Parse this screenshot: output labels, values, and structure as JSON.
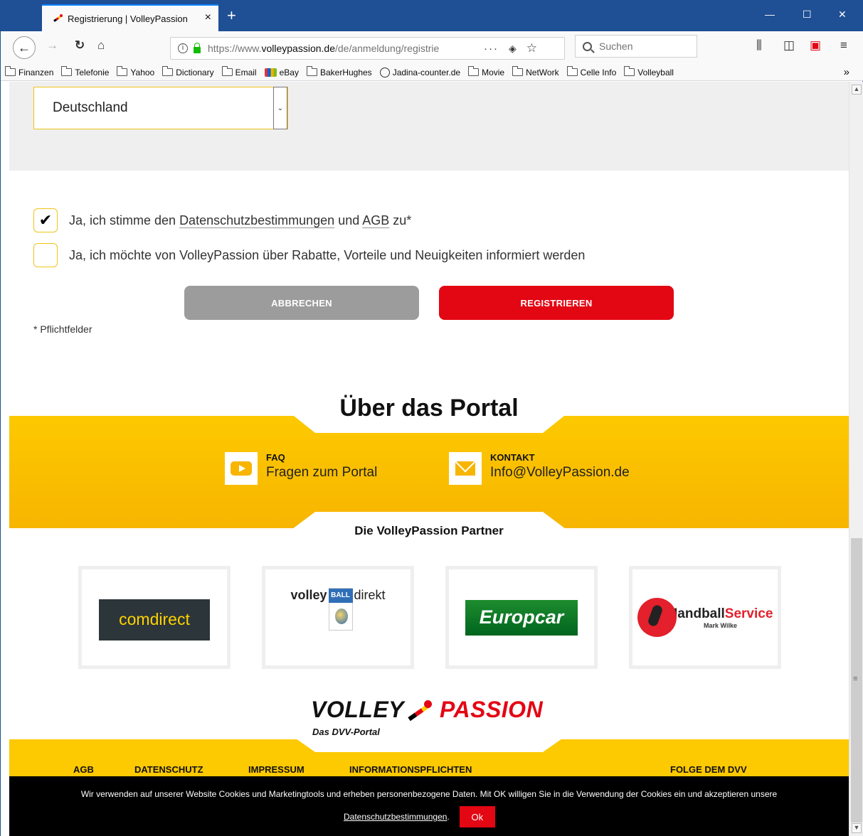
{
  "browser": {
    "tab_title": "Registrierung | VolleyPassion",
    "tab_close": "×",
    "new_tab": "+",
    "window_controls": {
      "minimize": "—",
      "maximize": "☐",
      "close": "✕"
    },
    "url_prefix": "https://www.",
    "url_domain": "volleypassion.de",
    "url_path": "/de/anmeldung/registrie",
    "page_actions": "···",
    "search_placeholder": "Suchen",
    "toolbar_icons": [
      "library-icon",
      "sidebar-icon",
      "pocket-icon",
      "menu-icon"
    ],
    "bookmarks": [
      "Finanzen",
      "Telefonie",
      "Yahoo",
      "Dictionary",
      "Email",
      "eBay",
      "BakerHughes",
      "Jadina-counter.de",
      "Movie",
      "NetWork",
      "Celle Info",
      "Volleyball"
    ],
    "bookmarks_overflow": "»"
  },
  "form": {
    "country_value": "Deutschland",
    "privacy_prefix": "Ja, ich stimme den ",
    "privacy_link": "Datenschutzbestimmungen",
    "privacy_and": " und ",
    "agb_link": "AGB",
    "privacy_suffix": " zu*",
    "privacy_checked": true,
    "newsletter_label": "Ja, ich möchte von VolleyPassion über Rabatte, Vorteile und Neuigkeiten informiert werden",
    "newsletter_checked": false,
    "cancel_label": "ABBRECHEN",
    "register_label": "REGISTRIEREN",
    "required_note": "* Pflichtfelder",
    "check_mark": "✔"
  },
  "portal": {
    "title": "Über das Portal",
    "faq_head": "FAQ",
    "faq_text": "Fragen zum Portal",
    "contact_head": "KONTAKT",
    "contact_text": "Info@VolleyPassion.de"
  },
  "partners": {
    "title": "Die VolleyPassion Partner",
    "comdirect": "comdirect",
    "volleyball_prefix": "volley",
    "volleyball_ball": "BALL",
    "volleyball_suffix": "direkt",
    "europcar": "Europcar",
    "handball_a": "Handball",
    "handball_b": "Service",
    "handball_sub": "Mark Wilke"
  },
  "brand": {
    "volley": "VOLLEY",
    "passion": "PASSION",
    "tagline": "Das DVV-Portal"
  },
  "footer": {
    "links": [
      "AGB",
      "DATENSCHUTZ",
      "IMPRESSUM",
      "INFORMATIONSPFLICHTEN"
    ],
    "follow": "FOLGE DEM DVV"
  },
  "cookie": {
    "message": "Wir verwenden auf unserer Website Cookies und Marketingtools und erheben personenbezogene Daten. Mit OK willigen Sie in die Verwendung der Cookies ein und akzeptieren unsere",
    "link": "Datenschutzbestimmungen",
    "period": ".",
    "ok": "Ok"
  },
  "colors": {
    "accent_yellow": "#fdc900",
    "brand_red": "#e30613",
    "browser_blue": "#1f4f94"
  }
}
